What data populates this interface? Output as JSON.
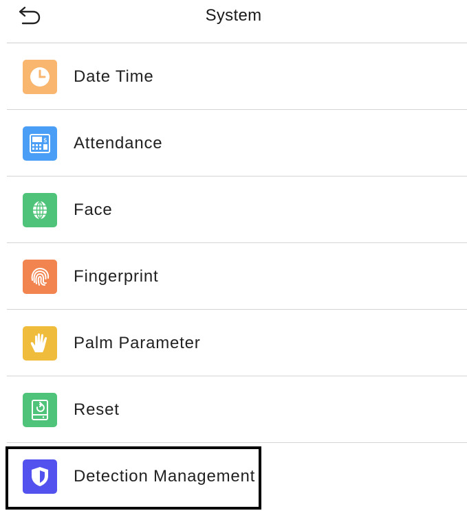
{
  "header": {
    "title": "System",
    "back_icon": "back-arrow-icon"
  },
  "menu": {
    "items": [
      {
        "label": "Date Time",
        "icon": "clock-icon",
        "color": "#F9B66F"
      },
      {
        "label": "Attendance",
        "icon": "attendance-terminal-icon",
        "color": "#4A9EF5"
      },
      {
        "label": "Face",
        "icon": "face-globe-icon",
        "color": "#4FC37A"
      },
      {
        "label": "Fingerprint",
        "icon": "fingerprint-icon",
        "color": "#F2844F"
      },
      {
        "label": "Palm Parameter",
        "icon": "palm-icon",
        "color": "#F0BC3C"
      },
      {
        "label": "Reset",
        "icon": "reset-device-icon",
        "color": "#4FC37A"
      },
      {
        "label": "Detection Management",
        "icon": "shield-icon",
        "color": "#5452EE"
      }
    ],
    "highlighted_item": "Detection Management"
  }
}
